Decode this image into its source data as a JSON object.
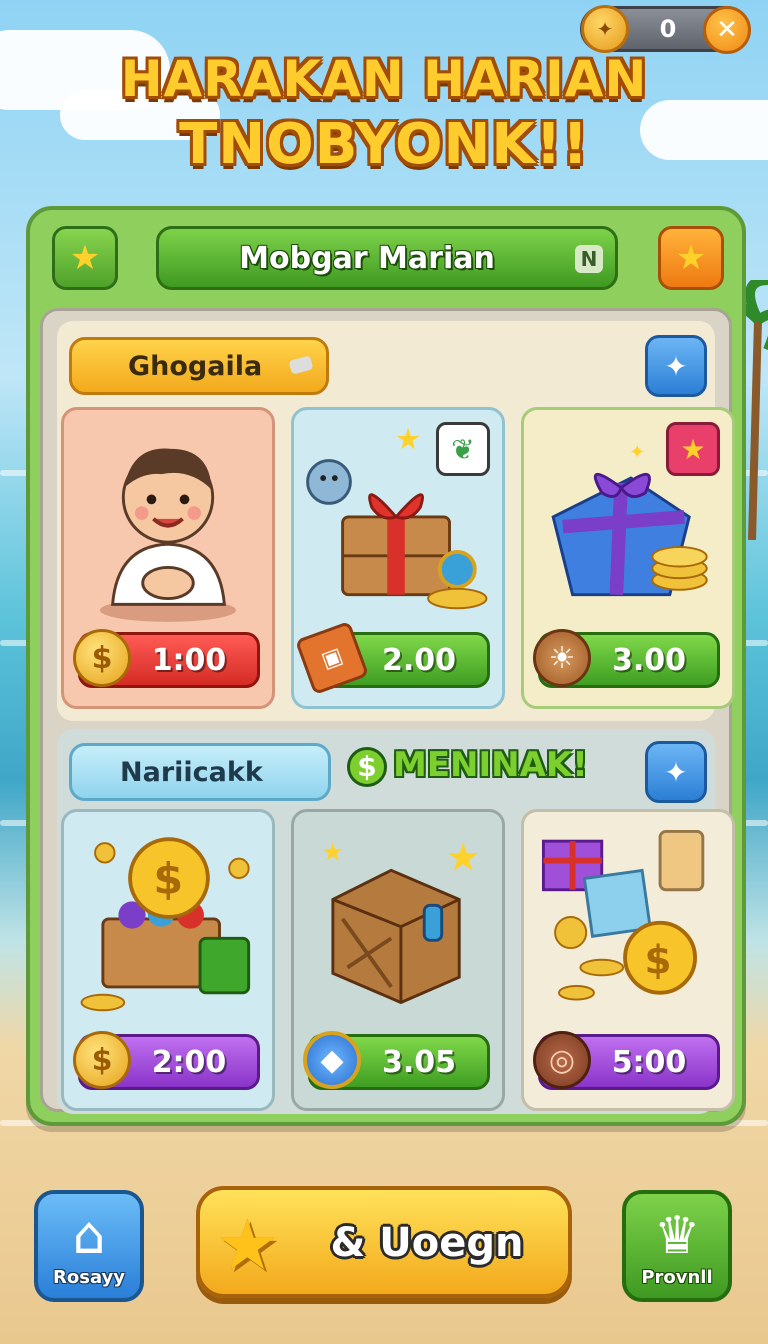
{
  "currency": {
    "count": "0",
    "icon": "gear-coin-icon",
    "close_icon": "close-icon"
  },
  "title": {
    "line1": "HARAKAN HARIAN",
    "line2": "TNOBYONK!!"
  },
  "header": {
    "label": "Mobgar Marian",
    "tag": "N",
    "left_icon": "star-icon",
    "right_icon": "star-icon"
  },
  "section1": {
    "label": "Ghogaila",
    "badge_icon": "pin-icon",
    "cards": [
      {
        "art": "character-boy",
        "price": "1:00",
        "price_icon": "coin-icon",
        "color": "#e8403a"
      },
      {
        "art": "gift-crate",
        "price": "2.00",
        "price_icon": "ticket-icon",
        "color": "#4fa82c",
        "badge_icon": "leaf-icon"
      },
      {
        "art": "blue-gift-box",
        "price": "3.00",
        "price_icon": "sun-icon",
        "color": "#4fa82c",
        "badge_icon": "star-icon"
      }
    ]
  },
  "section2": {
    "label": "Nariicakk",
    "promo": "MENINAK!",
    "badge_icon": "pin-icon",
    "cards": [
      {
        "art": "coin-chest",
        "price": "2:00",
        "price_icon": "coin-icon",
        "color": "#9b44d6"
      },
      {
        "art": "wooden-crate",
        "price": "3.05",
        "price_icon": "gem-icon",
        "color": "#4fa82c"
      },
      {
        "art": "gift-coins-drink",
        "price": "5:00",
        "price_icon": "bronze-coin-icon",
        "color": "#9b44d6"
      }
    ]
  },
  "nav": {
    "home_label": "Rosayy",
    "cta_label": "& Uoegn",
    "crown_label": "Provnll"
  }
}
